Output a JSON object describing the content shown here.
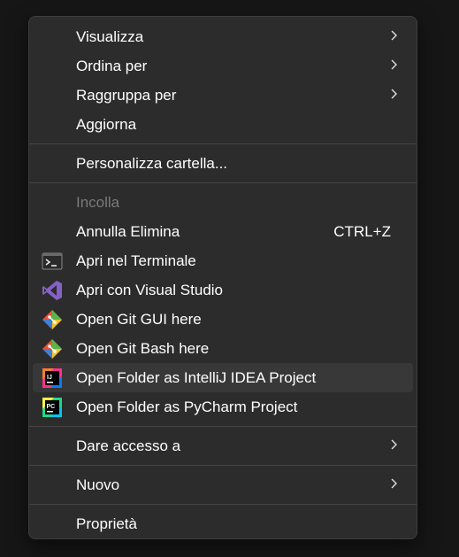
{
  "menu": {
    "items": [
      {
        "label": "Visualizza"
      },
      {
        "label": "Ordina per"
      },
      {
        "label": "Raggruppa per"
      },
      {
        "label": "Aggiorna"
      },
      {
        "label": "Personalizza cartella..."
      },
      {
        "label": "Incolla"
      },
      {
        "label": "Annulla Elimina",
        "shortcut": "CTRL+Z"
      },
      {
        "label": "Apri nel Terminale",
        "icon": "terminal-icon"
      },
      {
        "label": "Apri con Visual Studio",
        "icon": "visual-studio-icon"
      },
      {
        "label": "Open Git GUI here",
        "icon": "git-gui-icon"
      },
      {
        "label": "Open Git Bash here",
        "icon": "git-bash-icon"
      },
      {
        "label": "Open Folder as IntelliJ IDEA Project",
        "icon": "intellij-idea-icon"
      },
      {
        "label": "Open Folder as PyCharm Project",
        "icon": "pycharm-icon"
      },
      {
        "label": "Dare accesso a"
      },
      {
        "label": "Nuovo"
      },
      {
        "label": "Proprietà"
      }
    ]
  },
  "colors": {
    "menu_bg": "#2c2c2c",
    "hover_bg": "#383838",
    "text": "#ffffff",
    "disabled_text": "#7a7a7a",
    "separator": "#454545"
  }
}
